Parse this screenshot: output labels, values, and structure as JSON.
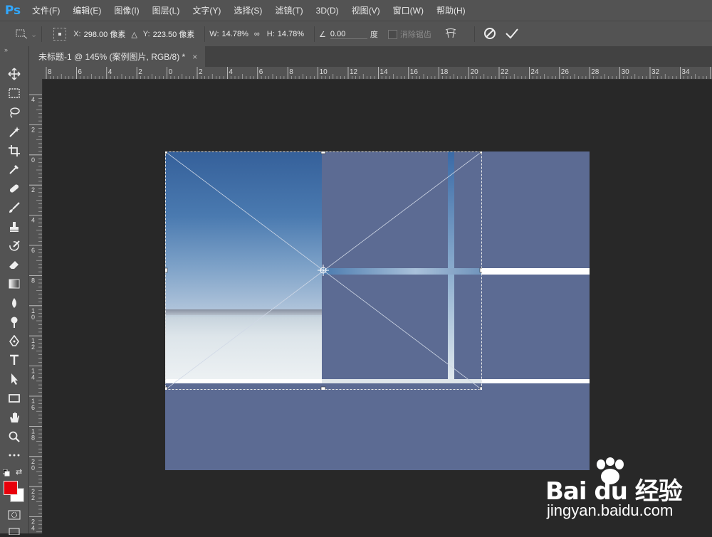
{
  "app": {
    "logo": "Ps"
  },
  "menu": [
    "文件(F)",
    "编辑(E)",
    "图像(I)",
    "图层(L)",
    "文字(Y)",
    "选择(S)",
    "滤镜(T)",
    "3D(D)",
    "视图(V)",
    "窗口(W)",
    "帮助(H)"
  ],
  "options": {
    "x_label": "X:",
    "x_value": "298.00 像素",
    "y_label": "Y:",
    "y_value": "223.50 像素",
    "w_label": "W:",
    "w_value": "14.78%",
    "h_label": "H:",
    "h_value": "14.78%",
    "angle_value": "0.00",
    "angle_unit": "度",
    "antialias_label": "消除锯齿"
  },
  "document_tab": {
    "title": "未标题-1 @ 145% (案例图片, RGB/8) *",
    "close": "×"
  },
  "ruler_top_labels": [
    "8",
    "6",
    "4",
    "2",
    "0",
    "2",
    "4",
    "6",
    "8",
    "10",
    "12",
    "14",
    "16",
    "18",
    "20",
    "22",
    "24",
    "26",
    "28",
    "30",
    "32",
    "34"
  ],
  "ruler_left_labels": [
    "4",
    "2",
    "0",
    "2",
    "4",
    "6",
    "8",
    "10",
    "12",
    "14",
    "16",
    "18",
    "20",
    "22",
    "24"
  ],
  "colors": {
    "foreground": "#e8000b",
    "background": "#ffffff",
    "canvas_fill": "#5c6b93"
  },
  "watermark": {
    "brand": "Bai du 经验",
    "url": "jingyan.baidu.com"
  }
}
